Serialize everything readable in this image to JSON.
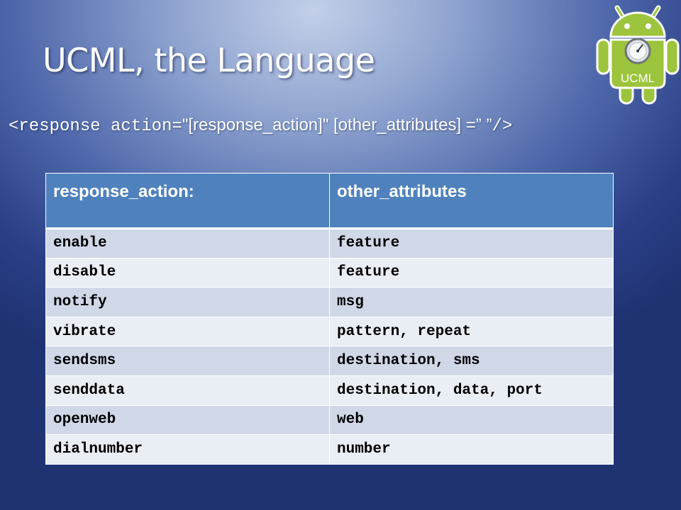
{
  "slide": {
    "title": "UCML, the Language",
    "syntax": {
      "part1": "<response action=",
      "part2": "\"[response_action]\" [other_attributes] =” ”",
      "part3": "/>"
    }
  },
  "logo": {
    "label": "UCML",
    "icon": "android-robot-gauge-icon",
    "colors": {
      "body": "#9cc43c",
      "outline": "#ffffff"
    }
  },
  "table": {
    "headers": [
      "response_action:",
      "other_attributes"
    ],
    "rows": [
      [
        "enable",
        "feature"
      ],
      [
        "disable",
        "feature"
      ],
      [
        "notify",
        "msg"
      ],
      [
        "vibrate",
        "pattern, repeat"
      ],
      [
        "sendsms",
        "destination, sms"
      ],
      [
        "senddata",
        "destination, data, port"
      ],
      [
        "openweb",
        "web"
      ],
      [
        "dialnumber",
        "number"
      ]
    ],
    "colors": {
      "header": "#4f81bd",
      "row_odd": "#d0d8e8",
      "row_even": "#e9edf4"
    }
  }
}
